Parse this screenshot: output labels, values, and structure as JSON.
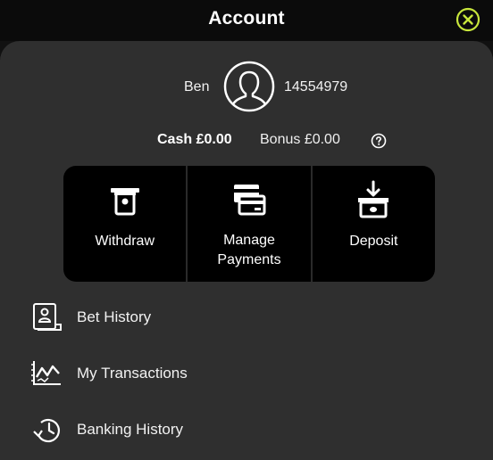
{
  "header": {
    "title": "Account",
    "close_icon": "close-circle-icon",
    "accent_color": "#c8e63c"
  },
  "user": {
    "name": "Ben",
    "id": "14554979",
    "avatar_icon": "user-avatar-icon"
  },
  "balance": {
    "cash": "Cash £0.00",
    "bonus": "Bonus £0.00",
    "help_icon": "help-icon"
  },
  "actions": [
    {
      "label": "Withdraw",
      "icon": "withdraw-icon"
    },
    {
      "label": "Manage Payments",
      "line1": "Manage",
      "line2": "Payments",
      "icon": "card-icon"
    },
    {
      "label": "Deposit",
      "icon": "deposit-icon"
    }
  ],
  "menu": [
    {
      "label": "Bet History",
      "icon": "receipt-icon"
    },
    {
      "label": "My Transactions",
      "icon": "chart-line-icon"
    },
    {
      "label": "Banking History",
      "icon": "history-icon"
    }
  ]
}
